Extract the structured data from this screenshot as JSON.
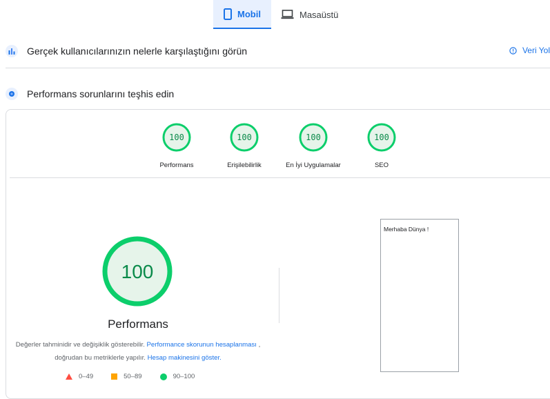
{
  "tabs": [
    {
      "label": "Mobil",
      "icon": "phone-icon",
      "active": true
    },
    {
      "label": "Masaüstü",
      "icon": "laptop-icon",
      "active": false
    }
  ],
  "field_data": {
    "icon": "crux-icon",
    "title": "Gerçek kullanıcılarınızın nelerle karşılaştığını görün",
    "link": "Veri Yol",
    "link_icon": "info-icon"
  },
  "diagnose": {
    "icon": "lighthouse-icon",
    "title": "Performans sorunlarını teşhis edin"
  },
  "scores": [
    {
      "label": "Performans",
      "value": "100"
    },
    {
      "label": "Erişilebilirlik",
      "value": "100"
    },
    {
      "label": "En İyi Uygulamalar",
      "value": "100"
    },
    {
      "label": "SEO",
      "value": "100"
    }
  ],
  "main_score": {
    "value": "100",
    "title": "Performans",
    "desc_part1": "Değerler tahminidir ve değişiklik gösterebilir. ",
    "desc_link1": "Performance skorunun hesaplanması",
    "desc_part2": " , doğrudan bu metriklerle yapılır. ",
    "desc_link2": "Hesap makinesini göster."
  },
  "legend": [
    {
      "label": "0–49",
      "shape": "triangle",
      "color": "#ff4e42"
    },
    {
      "label": "50–89",
      "shape": "square",
      "color": "#ffa400"
    },
    {
      "label": "90–100",
      "shape": "circle",
      "color": "#0cce6b"
    }
  ],
  "preview": {
    "text": "Merhaba Dünya !"
  },
  "colors": {
    "accent": "#1a73e8",
    "pass": "#0cce6b",
    "pass_bg": "#e6f4ea"
  }
}
